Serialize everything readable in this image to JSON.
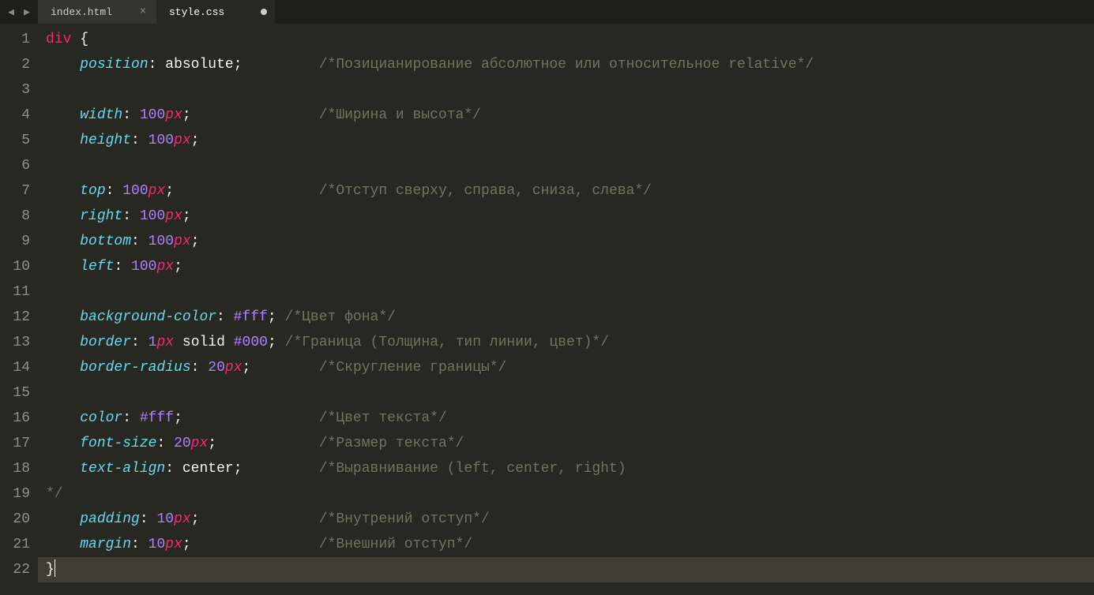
{
  "tabs": [
    {
      "name": "index.html",
      "active": false,
      "dirty": false
    },
    {
      "name": "style.css",
      "active": true,
      "dirty": true
    }
  ],
  "activeLine": 22,
  "colAfterIndent": 32,
  "code": [
    {
      "n": 1,
      "indent": 0,
      "tokens": [
        [
          "tag",
          "div"
        ],
        [
          "space",
          " "
        ],
        [
          "punct",
          "{"
        ]
      ]
    },
    {
      "n": 2,
      "indent": 1,
      "tokens": [
        [
          "prop",
          "position"
        ],
        [
          "punct",
          ":"
        ],
        [
          "space",
          " "
        ],
        [
          "val",
          "absolute"
        ],
        [
          "punct",
          ";"
        ]
      ],
      "comment": "/*Позицианирование абсолютное или относительное relative*/"
    },
    {
      "n": 3,
      "indent": 1,
      "tokens": []
    },
    {
      "n": 4,
      "indent": 1,
      "tokens": [
        [
          "prop",
          "width"
        ],
        [
          "punct",
          ":"
        ],
        [
          "space",
          " "
        ],
        [
          "num",
          "100"
        ],
        [
          "unit",
          "px"
        ],
        [
          "punct",
          ";"
        ]
      ],
      "comment": "/*Ширина и высота*/"
    },
    {
      "n": 5,
      "indent": 1,
      "tokens": [
        [
          "prop",
          "height"
        ],
        [
          "punct",
          ":"
        ],
        [
          "space",
          " "
        ],
        [
          "num",
          "100"
        ],
        [
          "unit",
          "px"
        ],
        [
          "punct",
          ";"
        ]
      ]
    },
    {
      "n": 6,
      "indent": 1,
      "tokens": []
    },
    {
      "n": 7,
      "indent": 1,
      "tokens": [
        [
          "prop",
          "top"
        ],
        [
          "punct",
          ":"
        ],
        [
          "space",
          " "
        ],
        [
          "num",
          "100"
        ],
        [
          "unit",
          "px"
        ],
        [
          "punct",
          ";"
        ]
      ],
      "comment": "/*Отступ сверху, справа, сниза, слева*/"
    },
    {
      "n": 8,
      "indent": 1,
      "tokens": [
        [
          "prop",
          "right"
        ],
        [
          "punct",
          ":"
        ],
        [
          "space",
          " "
        ],
        [
          "num",
          "100"
        ],
        [
          "unit",
          "px"
        ],
        [
          "punct",
          ";"
        ]
      ]
    },
    {
      "n": 9,
      "indent": 1,
      "tokens": [
        [
          "prop",
          "bottom"
        ],
        [
          "punct",
          ":"
        ],
        [
          "space",
          " "
        ],
        [
          "num",
          "100"
        ],
        [
          "unit",
          "px"
        ],
        [
          "punct",
          ";"
        ]
      ]
    },
    {
      "n": 10,
      "indent": 1,
      "tokens": [
        [
          "prop",
          "left"
        ],
        [
          "punct",
          ":"
        ],
        [
          "space",
          " "
        ],
        [
          "num",
          "100"
        ],
        [
          "unit",
          "px"
        ],
        [
          "punct",
          ";"
        ]
      ]
    },
    {
      "n": 11,
      "indent": 1,
      "tokens": []
    },
    {
      "n": 12,
      "indent": 1,
      "tokens": [
        [
          "prop",
          "background-color"
        ],
        [
          "punct",
          ":"
        ],
        [
          "space",
          " "
        ],
        [
          "num",
          "#fff"
        ],
        [
          "punct",
          ";"
        ]
      ],
      "comment": "/*Цвет фона*/",
      "tightComment": true
    },
    {
      "n": 13,
      "indent": 1,
      "tokens": [
        [
          "prop",
          "border"
        ],
        [
          "punct",
          ":"
        ],
        [
          "space",
          " "
        ],
        [
          "num",
          "1"
        ],
        [
          "unit",
          "px"
        ],
        [
          "space",
          " "
        ],
        [
          "val",
          "solid"
        ],
        [
          "space",
          " "
        ],
        [
          "num",
          "#000"
        ],
        [
          "punct",
          ";"
        ]
      ],
      "comment": "/*Граница (Толщина, тип линии, цвет)*/",
      "tightComment": true
    },
    {
      "n": 14,
      "indent": 1,
      "tokens": [
        [
          "prop",
          "border-radius"
        ],
        [
          "punct",
          ":"
        ],
        [
          "space",
          " "
        ],
        [
          "num",
          "20"
        ],
        [
          "unit",
          "px"
        ],
        [
          "punct",
          ";"
        ]
      ],
      "comment": "/*Скругление границы*/"
    },
    {
      "n": 15,
      "indent": 1,
      "tokens": []
    },
    {
      "n": 16,
      "indent": 1,
      "tokens": [
        [
          "prop",
          "color"
        ],
        [
          "punct",
          ":"
        ],
        [
          "space",
          " "
        ],
        [
          "num",
          "#fff"
        ],
        [
          "punct",
          ";"
        ]
      ],
      "comment": "/*Цвет текста*/"
    },
    {
      "n": 17,
      "indent": 1,
      "tokens": [
        [
          "prop",
          "font-size"
        ],
        [
          "punct",
          ":"
        ],
        [
          "space",
          " "
        ],
        [
          "num",
          "20"
        ],
        [
          "unit",
          "px"
        ],
        [
          "punct",
          ";"
        ]
      ],
      "comment": "/*Размер текста*/"
    },
    {
      "n": 18,
      "indent": 1,
      "tokens": [
        [
          "prop",
          "text-align"
        ],
        [
          "punct",
          ":"
        ],
        [
          "space",
          " "
        ],
        [
          "val",
          "center"
        ],
        [
          "punct",
          ";"
        ]
      ],
      "comment": "/*Выравнивание (left, center, right)"
    },
    {
      "n": 19,
      "indent": 0,
      "tokens": [
        [
          "comment",
          "*/"
        ]
      ]
    },
    {
      "n": 20,
      "indent": 1,
      "tokens": [
        [
          "prop",
          "padding"
        ],
        [
          "punct",
          ":"
        ],
        [
          "space",
          " "
        ],
        [
          "num",
          "10"
        ],
        [
          "unit",
          "px"
        ],
        [
          "punct",
          ";"
        ]
      ],
      "comment": "/*Внутрений отступ*/"
    },
    {
      "n": 21,
      "indent": 1,
      "tokens": [
        [
          "prop",
          "margin"
        ],
        [
          "punct",
          ":"
        ],
        [
          "space",
          " "
        ],
        [
          "num",
          "10"
        ],
        [
          "unit",
          "px"
        ],
        [
          "punct",
          ";"
        ]
      ],
      "comment": "/*Внешний отступ*/"
    },
    {
      "n": 22,
      "indent": 0,
      "tokens": [
        [
          "punct",
          "}"
        ]
      ],
      "cursorAfter": true
    }
  ]
}
